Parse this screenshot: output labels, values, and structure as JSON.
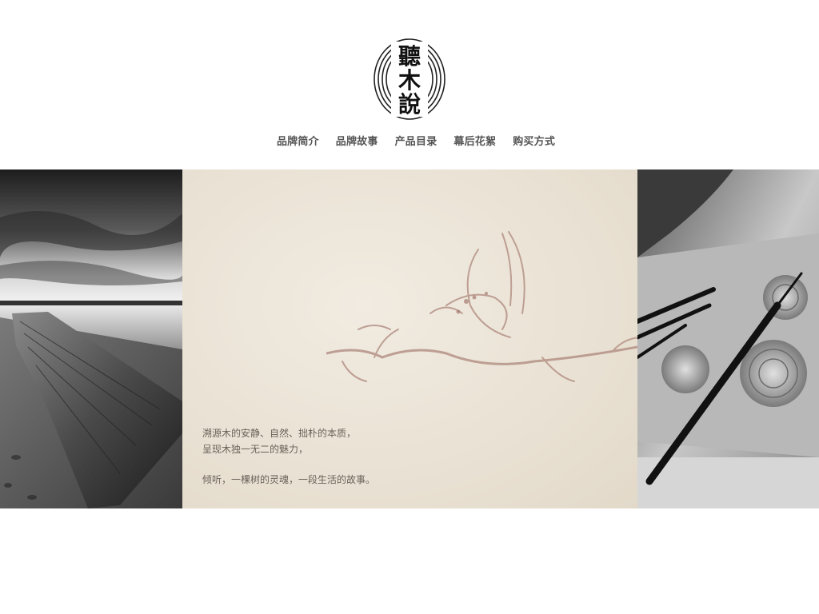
{
  "logo": {
    "characters": [
      "聽",
      "木",
      "說"
    ],
    "icon": "seal-logo"
  },
  "nav": {
    "items": [
      {
        "label": "品牌简介"
      },
      {
        "label": "品牌故事"
      },
      {
        "label": "产品目录"
      },
      {
        "label": "幕后花絮"
      },
      {
        "label": "购买方式"
      }
    ]
  },
  "banner": {
    "left_image": "weathered-wooden-pier-photo",
    "right_image": "wood-carving-chisels-photo",
    "center_image": "ink-lotus-flower-painting",
    "tagline": {
      "line1": "溯源木的安静、自然、拙朴的本质，",
      "line2": "呈现木独一无二的魅力，",
      "line3": "倾听，一棵树的灵魂，一段生活的故事。"
    }
  },
  "colors": {
    "background": "#ffffff",
    "nav_text": "#555555",
    "paper": "#e9e1d3",
    "tagline_text": "#6a6259"
  }
}
